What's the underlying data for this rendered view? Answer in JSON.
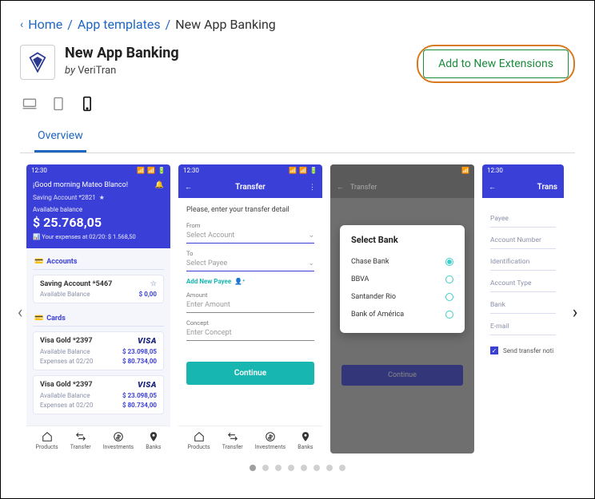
{
  "breadcrumb": {
    "home": "Home",
    "templates": "App templates",
    "current": "New App Banking"
  },
  "header": {
    "title": "New App Banking",
    "by_prefix": "by ",
    "vendor": "VeriTran",
    "cta": "Add to New Extensions"
  },
  "tabs": {
    "overview": "Overview"
  },
  "dots": {
    "count": 8,
    "active": 0
  },
  "shot1": {
    "time": "12:30",
    "greeting": "¡Good morning Mateo Blanco!",
    "saving_label": "Saving Account *2821",
    "avail_label": "Available balance",
    "balance": "$ 25.768,05",
    "expenses_line": "Your expenses at 02/20: $ 1.568,50",
    "accounts_label": "Accounts",
    "acct": {
      "name": "Saving Account *5467",
      "avail": "Available Balance",
      "amt": "$ 0,00"
    },
    "cards_label": "Cards",
    "card1": {
      "name": "Visa Gold *2397",
      "brand": "VISA",
      "avail": "Available Balance",
      "amt": "$ 23.098,05",
      "exp_l": "Expenses at 02/20",
      "exp": "$ 80.734,00"
    },
    "card2": {
      "name": "Visa Gold *2397",
      "brand": "VISA",
      "avail": "Available Balance",
      "amt": "$ 23.098,05",
      "exp_l": "Expenses at 02/20",
      "exp": "$ 80.734,00"
    },
    "nav": {
      "products": "Products",
      "transfer": "Transfer",
      "investments": "Investments",
      "banks": "Banks"
    }
  },
  "shot2": {
    "time": "12:30",
    "title": "Transfer",
    "please": "Please, enter your transfer detail",
    "from_l": "From",
    "from_v": "Select Account",
    "to_l": "To",
    "to_v": "Select Payee",
    "add_payee": "Add New Payee",
    "amount_l": "Amount",
    "amount_v": "Enter Amount",
    "concept_l": "Concept",
    "concept_v": "Enter Concept",
    "continue": "Continue"
  },
  "shot3": {
    "title": "Transfer",
    "modal_title": "Select Bank",
    "banks": [
      "Chase Bank",
      "BBVA",
      "Santander Rio",
      "Bank of América"
    ],
    "continue": "Continue"
  },
  "shot4": {
    "time": "12:30",
    "title": "Trans",
    "fields": [
      "Payee",
      "Account Number",
      "Identification",
      "Account Type",
      "Bank",
      "E-mail"
    ],
    "checkbox": "Send transfer noti"
  }
}
